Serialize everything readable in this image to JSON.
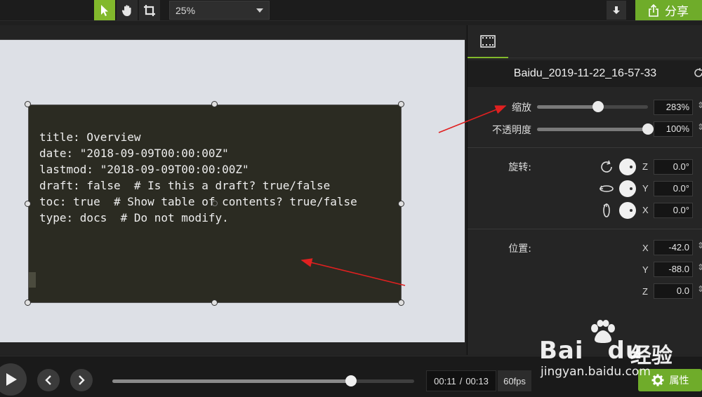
{
  "toolbar": {
    "zoom_value": "25%",
    "share_label": "分享"
  },
  "editor": {
    "code_lines": [
      "title: Overview",
      "date: \"2018-09-09T00:00:00Z\"",
      "lastmod: \"2018-09-09T00:00:00Z\"",
      "draft: false  # Is this a draft? true/false",
      "toc: true  # Show table of contents? true/false",
      "type: docs  # Do not modify."
    ]
  },
  "panel": {
    "clip_title": "Baidu_2019-11-22_16-57-33",
    "scale": {
      "label": "缩放",
      "value": "283%",
      "level": 0.55
    },
    "opacity": {
      "label": "不透明度",
      "value": "100%",
      "level": 1.0
    },
    "rotation": {
      "label": "旋转:",
      "z": {
        "axis": "Z",
        "value": "0.0°"
      },
      "y": {
        "axis": "Y",
        "value": "0.0°"
      },
      "x": {
        "axis": "X",
        "value": "0.0°"
      }
    },
    "position": {
      "label": "位置:",
      "x": {
        "axis": "X",
        "value": "-42.0"
      },
      "y": {
        "axis": "Y",
        "value": "-88.0"
      },
      "z": {
        "axis": "Z",
        "value": "0.0"
      }
    }
  },
  "playback": {
    "current_time": "00:11",
    "separator": "/",
    "total_time": "00:13",
    "fps": "60fps",
    "progress": 0.79,
    "properties_label": "属性"
  },
  "watermark": {
    "brand": "Bai",
    "brand2": "du",
    "cn": "经验",
    "url": "jingyan.baidu.com"
  },
  "colors": {
    "accent": "#82b92c",
    "annotation_arrow": "#e02020"
  }
}
